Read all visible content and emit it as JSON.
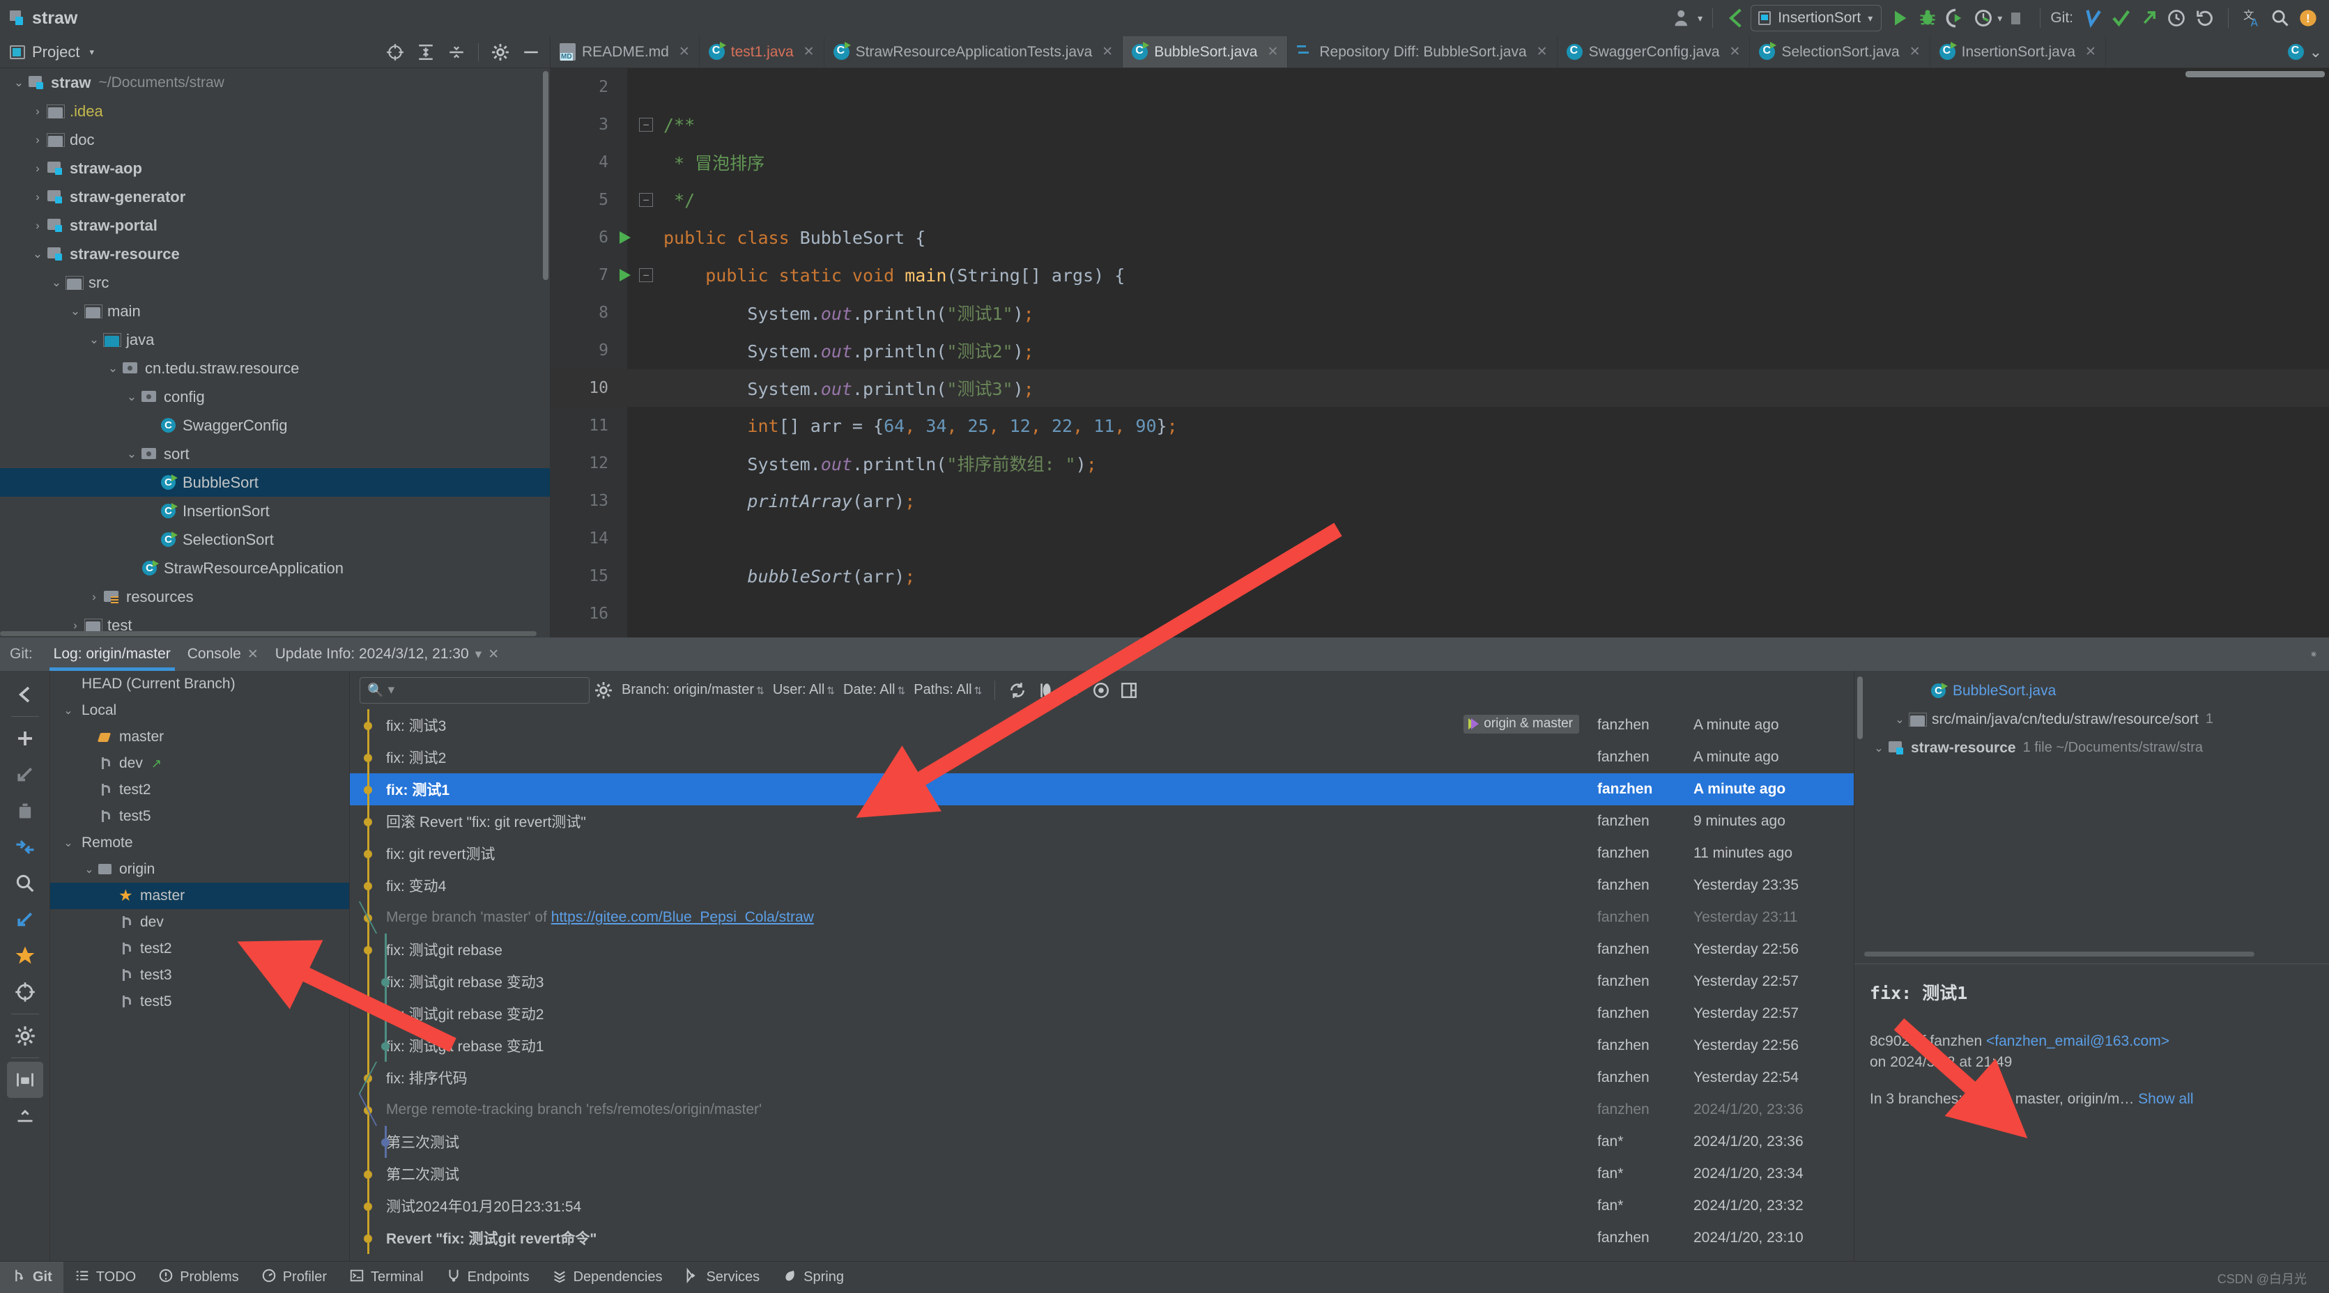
{
  "window": {
    "project_name": "straw"
  },
  "toolbar": {
    "run_config": "InsertionSort",
    "git_label": "Git:",
    "icons": [
      "user-avatar-icon",
      "back-arrow-icon",
      "run-icon",
      "debug-icon",
      "coverage-icon",
      "profile-icon",
      "stop-icon",
      "git-update-icon",
      "git-commit-icon",
      "git-push-icon",
      "history-icon",
      "rollback-icon",
      "translate-icon",
      "search-everywhere-icon",
      "notifications-icon"
    ]
  },
  "project_panel": {
    "title": "Project",
    "tree": [
      {
        "name": "straw",
        "path": "~/Documents/straw",
        "indent": 0,
        "arrow": "v",
        "icon": "module",
        "bold": true
      },
      {
        "name": ".idea",
        "path": "",
        "indent": 1,
        "arrow": ">",
        "icon": "folder",
        "bold": false,
        "color": "yellow"
      },
      {
        "name": "doc",
        "path": "",
        "indent": 1,
        "arrow": ">",
        "icon": "folder",
        "bold": false
      },
      {
        "name": "straw-aop",
        "path": "",
        "indent": 1,
        "arrow": ">",
        "icon": "module",
        "bold": true
      },
      {
        "name": "straw-generator",
        "path": "",
        "indent": 1,
        "arrow": ">",
        "icon": "module",
        "bold": true
      },
      {
        "name": "straw-portal",
        "path": "",
        "indent": 1,
        "arrow": ">",
        "icon": "module",
        "bold": true
      },
      {
        "name": "straw-resource",
        "path": "",
        "indent": 1,
        "arrow": "v",
        "icon": "module",
        "bold": true
      },
      {
        "name": "src",
        "path": "",
        "indent": 2,
        "arrow": "v",
        "icon": "folder",
        "bold": false
      },
      {
        "name": "main",
        "path": "",
        "indent": 3,
        "arrow": "v",
        "icon": "folder",
        "bold": false
      },
      {
        "name": "java",
        "path": "",
        "indent": 4,
        "arrow": "v",
        "icon": "folder-source",
        "bold": false
      },
      {
        "name": "cn.tedu.straw.resource",
        "path": "",
        "indent": 5,
        "arrow": "v",
        "icon": "package",
        "bold": false
      },
      {
        "name": "config",
        "path": "",
        "indent": 6,
        "arrow": "v",
        "icon": "package",
        "bold": false
      },
      {
        "name": "SwaggerConfig",
        "path": "",
        "indent": 7,
        "arrow": "",
        "icon": "class",
        "bold": false
      },
      {
        "name": "sort",
        "path": "",
        "indent": 6,
        "arrow": "v",
        "icon": "package",
        "bold": false
      },
      {
        "name": "BubbleSort",
        "path": "",
        "indent": 7,
        "arrow": "",
        "icon": "class-runnable",
        "bold": false,
        "selected": true
      },
      {
        "name": "InsertionSort",
        "path": "",
        "indent": 7,
        "arrow": "",
        "icon": "class-runnable",
        "bold": false
      },
      {
        "name": "SelectionSort",
        "path": "",
        "indent": 7,
        "arrow": "",
        "icon": "class-runnable",
        "bold": false
      },
      {
        "name": "StrawResourceApplication",
        "path": "",
        "indent": 6,
        "arrow": "",
        "icon": "class-spring",
        "bold": false
      },
      {
        "name": "resources",
        "path": "",
        "indent": 4,
        "arrow": ">",
        "icon": "resources",
        "bold": false
      },
      {
        "name": "test",
        "path": "",
        "indent": 3,
        "arrow": ">",
        "icon": "folder",
        "bold": false
      }
    ]
  },
  "editor_tabs": [
    {
      "label": "README.md",
      "icon": "markdown-icon",
      "active": false
    },
    {
      "label": "test1.java",
      "icon": "java-class-icon",
      "active": false,
      "error": true
    },
    {
      "label": "StrawResourceApplicationTests.java",
      "icon": "java-class-icon",
      "active": false
    },
    {
      "label": "BubbleSort.java",
      "icon": "java-class-runnable-icon",
      "active": true
    },
    {
      "label": "Repository Diff: BubbleSort.java",
      "icon": "diff-icon",
      "active": false
    },
    {
      "label": "SwaggerConfig.java",
      "icon": "java-class-icon",
      "active": false
    },
    {
      "label": "SelectionSort.java",
      "icon": "java-class-runnable-icon",
      "active": false
    },
    {
      "label": "InsertionSort.java",
      "icon": "java-class-runnable-icon",
      "active": false
    }
  ],
  "editor": {
    "lines": [
      {
        "num": "2",
        "gutter": "",
        "tokens": []
      },
      {
        "num": "3",
        "gutter": "fold-open",
        "tokens": [
          {
            "t": "cmt",
            "v": "/**"
          }
        ]
      },
      {
        "num": "4",
        "gutter": "",
        "tokens": [
          {
            "t": "cmt",
            "v": " * 冒泡排序"
          }
        ]
      },
      {
        "num": "5",
        "gutter": "fold-close",
        "tokens": [
          {
            "t": "cmt",
            "v": " */"
          }
        ]
      },
      {
        "num": "6",
        "gutter": "run",
        "tokens": [
          {
            "t": "kw",
            "v": "public class "
          },
          {
            "t": "id",
            "v": "BubbleSort {"
          }
        ]
      },
      {
        "num": "7",
        "gutter": "run-fold",
        "tokens": [
          {
            "t": "sp",
            "v": "    "
          },
          {
            "t": "kw",
            "v": "public static void "
          },
          {
            "t": "fn",
            "v": "main"
          },
          {
            "t": "id",
            "v": "(String[] args) {"
          }
        ]
      },
      {
        "num": "8",
        "gutter": "",
        "tokens": [
          {
            "t": "sp",
            "v": "        "
          },
          {
            "t": "id",
            "v": "System."
          },
          {
            "t": "fld",
            "v": "out"
          },
          {
            "t": "id",
            "v": ".println("
          },
          {
            "t": "str",
            "v": "\"测试1\""
          },
          {
            "t": "id",
            "v": ")"
          },
          {
            "t": "kw",
            "v": ";"
          }
        ]
      },
      {
        "num": "9",
        "gutter": "",
        "tokens": [
          {
            "t": "sp",
            "v": "        "
          },
          {
            "t": "id",
            "v": "System."
          },
          {
            "t": "fld",
            "v": "out"
          },
          {
            "t": "id",
            "v": ".println("
          },
          {
            "t": "str",
            "v": "\"测试2\""
          },
          {
            "t": "id",
            "v": ")"
          },
          {
            "t": "kw",
            "v": ";"
          }
        ]
      },
      {
        "num": "10",
        "gutter": "",
        "highlight": true,
        "tokens": [
          {
            "t": "sp",
            "v": "        "
          },
          {
            "t": "id",
            "v": "System."
          },
          {
            "t": "fld",
            "v": "out"
          },
          {
            "t": "id",
            "v": ".println("
          },
          {
            "t": "str",
            "v": "\"测试3\""
          },
          {
            "t": "id",
            "v": ")"
          },
          {
            "t": "kw",
            "v": ";"
          }
        ]
      },
      {
        "num": "11",
        "gutter": "",
        "tokens": [
          {
            "t": "sp",
            "v": "        "
          },
          {
            "t": "kw",
            "v": "int"
          },
          {
            "t": "id",
            "v": "[] arr = {"
          },
          {
            "t": "num",
            "v": "64"
          },
          {
            "t": "kw",
            "v": ","
          },
          {
            "t": "num",
            "v": " 34"
          },
          {
            "t": "kw",
            "v": ","
          },
          {
            "t": "num",
            "v": " 25"
          },
          {
            "t": "kw",
            "v": ","
          },
          {
            "t": "num",
            "v": " 12"
          },
          {
            "t": "kw",
            "v": ","
          },
          {
            "t": "num",
            "v": " 22"
          },
          {
            "t": "kw",
            "v": ","
          },
          {
            "t": "num",
            "v": " 11"
          },
          {
            "t": "kw",
            "v": ","
          },
          {
            "t": "num",
            "v": " 90"
          },
          {
            "t": "id",
            "v": "}"
          },
          {
            "t": "kw",
            "v": ";"
          }
        ]
      },
      {
        "num": "12",
        "gutter": "",
        "tokens": [
          {
            "t": "sp",
            "v": "        "
          },
          {
            "t": "id",
            "v": "System."
          },
          {
            "t": "fld",
            "v": "out"
          },
          {
            "t": "id",
            "v": ".println("
          },
          {
            "t": "str",
            "v": "\"排序前数组: \""
          },
          {
            "t": "id",
            "v": ")"
          },
          {
            "t": "kw",
            "v": ";"
          }
        ]
      },
      {
        "num": "13",
        "gutter": "",
        "tokens": [
          {
            "t": "sp",
            "v": "        "
          },
          {
            "t": "mth",
            "v": "printArray"
          },
          {
            "t": "id",
            "v": "(arr)"
          },
          {
            "t": "kw",
            "v": ";"
          }
        ]
      },
      {
        "num": "14",
        "gutter": "",
        "tokens": []
      },
      {
        "num": "15",
        "gutter": "",
        "tokens": [
          {
            "t": "sp",
            "v": "        "
          },
          {
            "t": "mth",
            "v": "bubbleSort"
          },
          {
            "t": "id",
            "v": "(arr)"
          },
          {
            "t": "kw",
            "v": ";"
          }
        ]
      },
      {
        "num": "16",
        "gutter": "",
        "tokens": []
      }
    ]
  },
  "git_panel": {
    "label": "Git:",
    "tabs": [
      {
        "label": "Log: origin/master",
        "active": true,
        "closable": false
      },
      {
        "label": "Console",
        "active": false,
        "closable": true
      },
      {
        "label": "Update Info: 2024/3/12, 21:30",
        "active": false,
        "closable": true,
        "dropdown": true
      }
    ],
    "branches": [
      {
        "label": "HEAD (Current Branch)",
        "indent": 0,
        "arrow": "",
        "icon": ""
      },
      {
        "label": "Local",
        "indent": 0,
        "arrow": "v",
        "icon": ""
      },
      {
        "label": "master",
        "indent": 1,
        "arrow": "",
        "icon": "tag"
      },
      {
        "label": "dev",
        "indent": 1,
        "arrow": "",
        "icon": "branch",
        "badge": "↗"
      },
      {
        "label": "test2",
        "indent": 1,
        "arrow": "",
        "icon": "branch"
      },
      {
        "label": "test5",
        "indent": 1,
        "arrow": "",
        "icon": "branch"
      },
      {
        "label": "Remote",
        "indent": 0,
        "arrow": "v",
        "icon": ""
      },
      {
        "label": "origin",
        "indent": 1,
        "arrow": "v",
        "icon": "folder"
      },
      {
        "label": "master",
        "indent": 2,
        "arrow": "",
        "icon": "star",
        "selected": true
      },
      {
        "label": "dev",
        "indent": 2,
        "arrow": "",
        "icon": "branch"
      },
      {
        "label": "test2",
        "indent": 2,
        "arrow": "",
        "icon": "branch"
      },
      {
        "label": "test3",
        "indent": 2,
        "arrow": "",
        "icon": "branch"
      },
      {
        "label": "test5",
        "indent": 2,
        "arrow": "",
        "icon": "branch"
      }
    ],
    "filters": {
      "search_placeholder": "",
      "branch": "Branch: origin/master",
      "user": "User: All",
      "date": "Date: All",
      "paths": "Paths: All"
    },
    "commits": [
      {
        "message": "fix: 测试3",
        "author": "fanzhen",
        "date": "A minute ago",
        "ref": "origin & master",
        "graph": "main"
      },
      {
        "message": "fix: 测试2",
        "author": "fanzhen",
        "date": "A minute ago",
        "graph": "main"
      },
      {
        "message": "fix: 测试1",
        "author": "fanzhen",
        "date": "A minute ago",
        "selected": true,
        "graph": "main"
      },
      {
        "message": "回滚 Revert \"fix: git revert测试\"",
        "author": "fanzhen",
        "date": "9 minutes ago",
        "graph": "main"
      },
      {
        "message": "fix: git revert测试",
        "author": "fanzhen",
        "date": "11 minutes ago",
        "graph": "main"
      },
      {
        "message": "fix: 变动4",
        "author": "fanzhen",
        "date": "Yesterday 23:35",
        "graph": "main"
      },
      {
        "message": "Merge branch 'master' of ",
        "link": "https://gitee.com/Blue_Pepsi_Cola/straw",
        "author": "fanzhen",
        "date": "Yesterday 23:11",
        "merge": true,
        "graph": "fork"
      },
      {
        "message": "fix: 测试git rebase",
        "author": "fanzhen",
        "date": "Yesterday 22:56",
        "graph": "main-teal"
      },
      {
        "message": "fix: 测试git rebase 变动3",
        "author": "fanzhen",
        "date": "Yesterday 22:57",
        "graph": "teal"
      },
      {
        "message": "fix: 测试git rebase 变动2",
        "author": "fanzhen",
        "date": "Yesterday 22:57",
        "graph": "teal"
      },
      {
        "message": "fix: 测试git rebase 变动1",
        "author": "fanzhen",
        "date": "Yesterday 22:56",
        "graph": "teal"
      },
      {
        "message": "fix: 排序代码",
        "author": "fanzhen",
        "date": "Yesterday 22:54",
        "graph": "main-merge-teal"
      },
      {
        "message": "Merge remote-tracking branch 'refs/remotes/origin/master'",
        "author": "fanzhen",
        "date": "2024/1/20, 23:36",
        "merge": true,
        "graph": "fork-blue"
      },
      {
        "message": "第三次测试",
        "author": "fan*",
        "date": "2024/1/20, 23:36",
        "graph": "blue"
      },
      {
        "message": "第二次测试",
        "author": "fan*",
        "date": "2024/1/20, 23:34",
        "graph": "main"
      },
      {
        "message": "测试2024年01月20日23:31:54",
        "author": "fan*",
        "date": "2024/1/20, 23:32",
        "graph": "main"
      },
      {
        "message": "Revert \"fix: 测试git revert命令\"",
        "author": "fanzhen",
        "date": "2024/1/20, 23:10",
        "bold": true,
        "graph": "main"
      }
    ],
    "details": {
      "changed_files": [
        {
          "label": "straw-resource",
          "sub": "1 file  ~/Documents/straw/stra",
          "indent": 0,
          "arrow": "v",
          "icon": "module"
        },
        {
          "label": "src/main/java/cn/tedu/straw/resource/sort",
          "sub": "1",
          "indent": 1,
          "arrow": "v",
          "icon": "folder"
        },
        {
          "label": "BubbleSort.java",
          "sub": "",
          "indent": 2,
          "arrow": "",
          "icon": "class-runnable",
          "file": true
        }
      ],
      "commit_title": "fix: 测试1",
      "commit_hash": "8c902f5f",
      "commit_author": "fanzhen",
      "commit_email": "<fanzhen_email@163.com>",
      "commit_when": "on 2024/3/12 at 21:49",
      "branches_text": "In 3 branches: HEAD, master, origin/m…",
      "show_all": "Show all"
    }
  },
  "status_bar": {
    "items": [
      {
        "label": "Git",
        "icon": "branch-icon",
        "active": true
      },
      {
        "label": "TODO",
        "icon": "list-icon",
        "active": false
      },
      {
        "label": "Problems",
        "icon": "warning-icon",
        "active": false
      },
      {
        "label": "Profiler",
        "icon": "profiler-icon",
        "active": false
      },
      {
        "label": "Terminal",
        "icon": "terminal-icon",
        "active": false
      },
      {
        "label": "Endpoints",
        "icon": "endpoints-icon",
        "active": false
      },
      {
        "label": "Dependencies",
        "icon": "dependencies-icon",
        "active": false
      },
      {
        "label": "Services",
        "icon": "services-icon",
        "active": false
      },
      {
        "label": "Spring",
        "icon": "spring-icon",
        "active": false
      }
    ],
    "watermark": "CSDN @白月光"
  },
  "colors": {
    "accent": "#3d93d8",
    "selection": "#2675d9",
    "tree_selection": "#0d3a58",
    "annotation_arrow": "#f4473f",
    "background": "#3c3f41",
    "editor_background": "#2b2b2b"
  }
}
